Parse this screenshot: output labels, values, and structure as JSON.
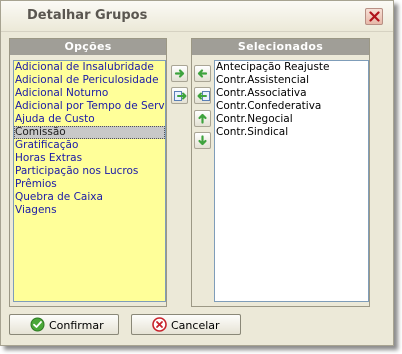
{
  "window": {
    "title": "Detalhar Grupos"
  },
  "left_panel": {
    "header": "Opções",
    "items": [
      "Adicional de Insalubridade",
      "Adicional de Periculosidade",
      "Adicional Noturno",
      "Adicional por Tempo de Serviço",
      "Ajuda de Custo",
      "Comissão",
      "Gratificação",
      "Horas Extras",
      "Participação nos Lucros",
      "Prêmios",
      "Quebra de Caixa",
      "Viagens"
    ],
    "selected_item": "Comissão"
  },
  "right_panel": {
    "header": "Selecionados",
    "items": [
      "Antecipação Reajuste",
      "Contr.Assistencial",
      "Contr.Associativa",
      "Contr.Confederativa",
      "Contr.Negocial",
      "Contr.Sindical"
    ]
  },
  "buttons": {
    "confirm": "Confirmar",
    "cancel": "Cancelar"
  },
  "icons": {
    "close": "close-icon",
    "add": "arrow-right-icon",
    "add_all": "move-all-right-icon",
    "remove": "arrow-left-icon",
    "remove_all": "move-all-left-icon",
    "move_up": "arrow-up-icon",
    "move_down": "arrow-down-icon",
    "confirm": "check-circle-icon",
    "cancel": "cancel-circle-icon"
  },
  "colors": {
    "list_background": "#ffff99",
    "item_text": "#1a1aa8",
    "header_background": "#a09e97",
    "arrow_green": "#3ea33e"
  }
}
